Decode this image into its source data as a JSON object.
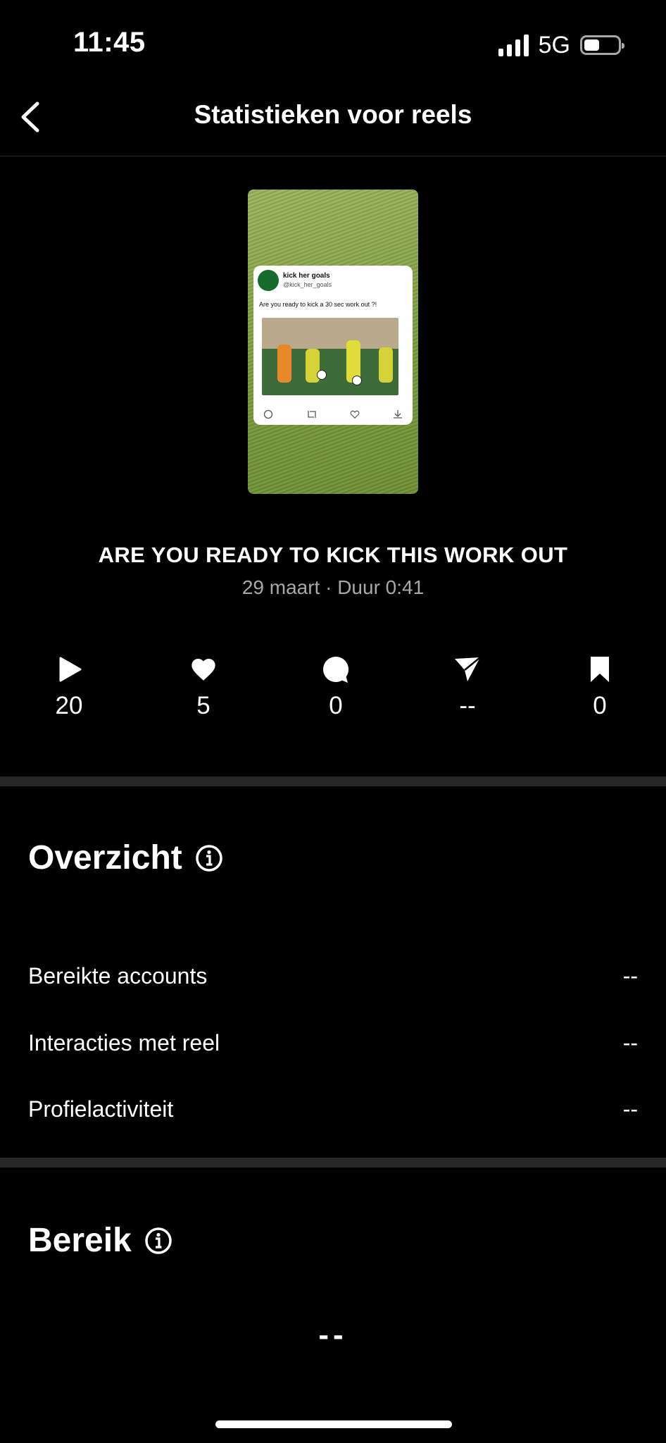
{
  "status_bar": {
    "time": "11:45",
    "network": "5G",
    "battery_level": 0.45
  },
  "header": {
    "title": "Statistieken voor reels",
    "back_icon": "chevron-left-icon"
  },
  "preview": {
    "tweet": {
      "name": "kick her goals",
      "handle": "@kick_her_goals",
      "text": "Are you ready to kick a 30 sec work out ?!",
      "actions": [
        "reply-icon",
        "retweet-icon",
        "like-icon",
        "download-icon"
      ]
    }
  },
  "reel": {
    "title": "ARE YOU READY TO KICK THIS WORK OUT",
    "meta": "29 maart · Duur 0:41"
  },
  "metrics": [
    {
      "icon": "play-icon",
      "value": "20"
    },
    {
      "icon": "heart-icon",
      "value": "5"
    },
    {
      "icon": "comment-icon",
      "value": "0"
    },
    {
      "icon": "share-icon",
      "value": "--"
    },
    {
      "icon": "bookmark-icon",
      "value": "0"
    }
  ],
  "overview": {
    "title": "Overzicht",
    "rows": [
      {
        "label": "Bereikte accounts",
        "value": "--"
      },
      {
        "label": "Interacties met reel",
        "value": "--"
      },
      {
        "label": "Profielactiviteit",
        "value": "--"
      }
    ]
  },
  "reach": {
    "title": "Bereik",
    "value": "--"
  }
}
